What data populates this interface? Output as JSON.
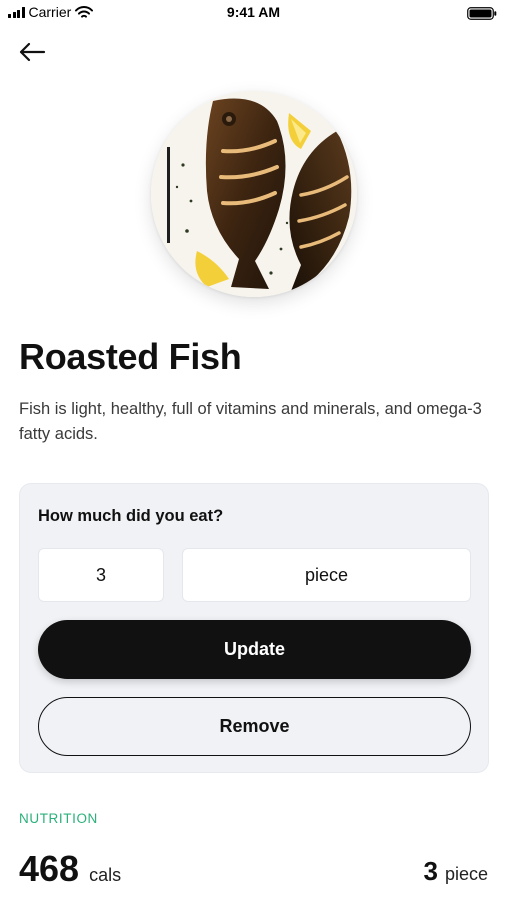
{
  "status_bar": {
    "carrier": "Carrier",
    "time": "9:41 AM",
    "icons": [
      "signal-bars-icon",
      "wifi-icon",
      "battery-icon"
    ]
  },
  "nav": {
    "back_icon": "arrow-left-icon"
  },
  "food": {
    "image": "roasted-fish-photo",
    "title": "Roasted Fish",
    "description": "Fish is light, healthy, full of vitamins and minerals, and omega-3 fatty acids."
  },
  "portion": {
    "question": "How much did you eat?",
    "quantity": "3",
    "unit": "piece",
    "update_label": "Update",
    "remove_label": "Remove"
  },
  "nutrition": {
    "section_label": "NUTRITION",
    "calories_value": "468",
    "calories_unit": "cals",
    "portion_qty": "3",
    "portion_unit": "piece"
  },
  "colors": {
    "accent_green": "#2bb07a",
    "primary_button": "#111111",
    "card_background": "#f0f2f5"
  }
}
